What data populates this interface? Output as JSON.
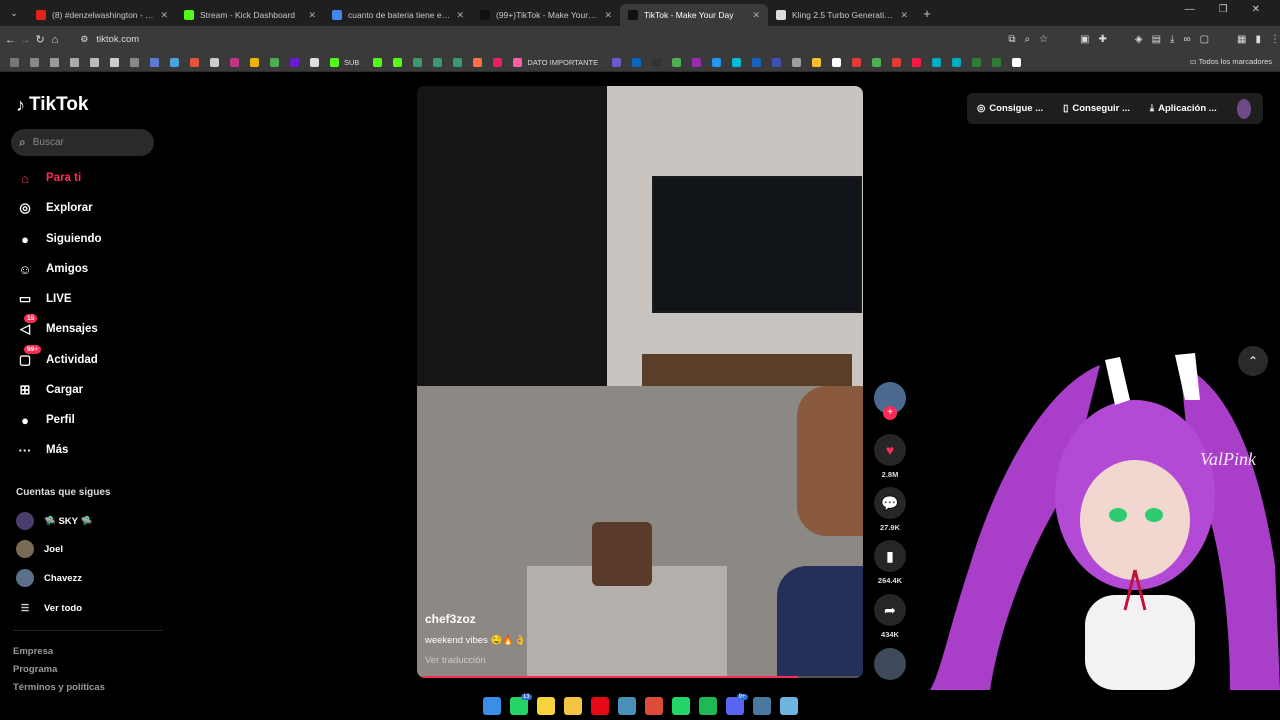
{
  "browser": {
    "tabs": [
      {
        "title": "(8) #denzelwashington - YouTube",
        "color": "#e62117",
        "active": false
      },
      {
        "title": "Stream - Kick Dashboard",
        "color": "#53fc18",
        "active": false
      },
      {
        "title": "cuanto de bateria tiene el samsung",
        "color": "#4285f4",
        "active": false
      },
      {
        "title": "(99+)TikTok - Make Your Day",
        "color": "#111111",
        "active": false
      },
      {
        "title": "TikTok - Make Your Day",
        "color": "#111111",
        "active": true
      },
      {
        "title": "Kling 2.5 Turbo Generative AI M",
        "color": "#dddddd",
        "active": false
      }
    ],
    "url": "tiktok.com",
    "bookmarks_text": {
      "sub": "SUB",
      "dato": "DATO IMPORTANTE",
      "all": "Todos los marcadores"
    },
    "bookmark_colors": [
      "#777777",
      "#888888",
      "#999999",
      "#aaaaaa",
      "#bbbbbb",
      "#cccccc",
      "#888888",
      "#5b7bd6",
      "#4aa3df",
      "#e6533c",
      "#cccccc",
      "#c13584",
      "#f0b400",
      "#4caf50",
      "#6a1bd1",
      "#dddddd",
      "#53fc18",
      "#53fc18",
      "#53fc18",
      "#3d9970",
      "#3d9970",
      "#3d9970",
      "#ff7043",
      "#e91e63",
      "#ff5fa2",
      "#6a5acd",
      "#0a66c2",
      "#333333",
      "#4caf50",
      "#9c27b0",
      "#2196f3",
      "#00bcd4",
      "#1565c0",
      "#3f51b5",
      "#9e9e9e",
      "#fbc02d",
      "#ffffff",
      "#e53935",
      "#4caf50",
      "#e53935",
      "#ff1744",
      "#00acc1",
      "#00acc1",
      "#2e7d32",
      "#2e7d32",
      "#ffffff"
    ]
  },
  "sidebar": {
    "logo": "TikTok",
    "search_placeholder": "Buscar",
    "nav": [
      {
        "label": "Para ti",
        "icon": "home-icon",
        "glyph": "⌂",
        "active": true,
        "badge": ""
      },
      {
        "label": "Explorar",
        "icon": "compass-icon",
        "glyph": "◎",
        "active": false,
        "badge": ""
      },
      {
        "label": "Siguiendo",
        "icon": "following-avatar-icon",
        "glyph": "●",
        "active": false,
        "badge": ""
      },
      {
        "label": "Amigos",
        "icon": "friends-icon",
        "glyph": "☺",
        "active": false,
        "badge": ""
      },
      {
        "label": "LIVE",
        "icon": "live-tv-icon",
        "glyph": "▭",
        "active": false,
        "badge": ""
      },
      {
        "label": "Mensajes",
        "icon": "messages-icon",
        "glyph": "◁",
        "active": false,
        "badge": "15"
      },
      {
        "label": "Actividad",
        "icon": "activity-icon",
        "glyph": "▢",
        "active": false,
        "badge": "99+"
      },
      {
        "label": "Cargar",
        "icon": "upload-icon",
        "glyph": "⊞",
        "active": false,
        "badge": ""
      },
      {
        "label": "Perfil",
        "icon": "profile-icon",
        "glyph": "●",
        "active": false,
        "badge": ""
      },
      {
        "label": "Más",
        "icon": "more-icon",
        "glyph": "···",
        "active": false,
        "badge": ""
      }
    ],
    "following_title": "Cuentas que sigues",
    "following": [
      {
        "name": "🛸 SKY 🛸",
        "color": "#4a3d6b"
      },
      {
        "name": "Joel",
        "color": "#7a6a55"
      },
      {
        "name": "Chavezz",
        "color": "#5a6f8a"
      }
    ],
    "see_all": "Ver todo",
    "footer": [
      "Empresa",
      "Programa",
      "Términos y políticas"
    ]
  },
  "video": {
    "author": "chef3zoz",
    "description": "weekend vibes 🤤🔥👌",
    "translate": "Ver traducción",
    "progress": 0.86
  },
  "actions": {
    "likes": "2.8M",
    "comments": "27.9K",
    "saves": "264.4K",
    "shares": "434K"
  },
  "topright": {
    "coins": "Consigue ...",
    "app": "Conseguir ...",
    "download": "Aplicación ..."
  },
  "overlay": {
    "watermark": "ValPink"
  },
  "taskbar": {
    "apps": [
      {
        "name": "windows-start",
        "color": "#3a8ee6",
        "badge": ""
      },
      {
        "name": "whatsapp",
        "color": "#25d366",
        "badge": "13"
      },
      {
        "name": "sticky-notes",
        "color": "#f7d33c",
        "badge": ""
      },
      {
        "name": "file-explorer",
        "color": "#f4c542",
        "badge": ""
      },
      {
        "name": "netflix",
        "color": "#e50914",
        "badge": ""
      },
      {
        "name": "vm-app",
        "color": "#4a8fb8",
        "badge": ""
      },
      {
        "name": "chrome",
        "color": "#dd4b39",
        "badge": ""
      },
      {
        "name": "whatsapp-2",
        "color": "#25d366",
        "badge": ""
      },
      {
        "name": "spotify",
        "color": "#1db954",
        "badge": ""
      },
      {
        "name": "discord",
        "color": "#5865f2",
        "badge": "9+"
      },
      {
        "name": "steam",
        "color": "#4a78a0",
        "badge": ""
      },
      {
        "name": "notepad",
        "color": "#6fb3e0",
        "badge": ""
      }
    ]
  }
}
